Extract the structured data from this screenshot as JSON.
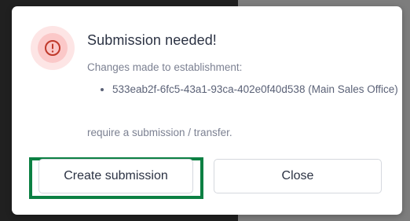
{
  "dialog": {
    "title": "Submission needed!",
    "intro": "Changes made to establishment:",
    "changes": [
      "533eab2f-6fc5-43a1-93ca-402e0f40d538 (Main Sales Office)"
    ],
    "outro": "require a submission / transfer.",
    "create_label": "Create submission",
    "close_label": "Close",
    "icon": "alert-circle-icon"
  },
  "colors": {
    "alert_accent": "#c0392b",
    "focus_outline": "#0c8043",
    "text_primary": "#2b3243",
    "text_muted": "#7c8192"
  }
}
